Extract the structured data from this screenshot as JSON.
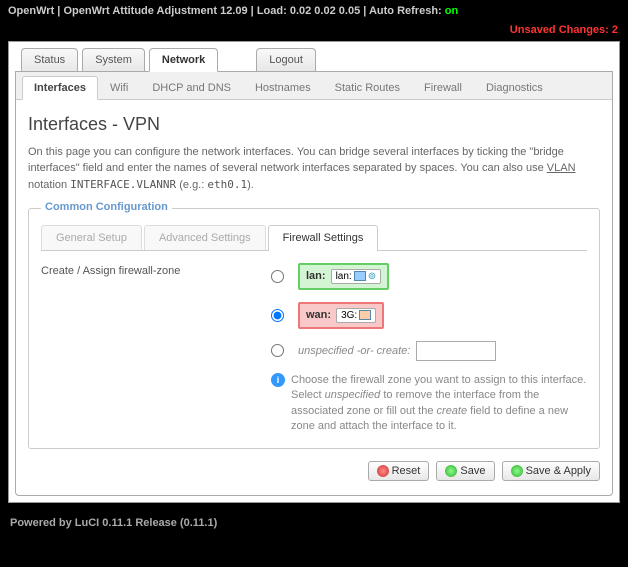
{
  "header": {
    "brand": "OpenWrt",
    "subtitle": "OpenWrt Attitude Adjustment 12.09",
    "load_label": "Load:",
    "load_values": "0.02 0.02 0.05",
    "autorefresh_label": "Auto Refresh:",
    "autorefresh_state": "on"
  },
  "unsaved": "Unsaved Changes: 2",
  "maintabs": {
    "status": "Status",
    "system": "System",
    "network": "Network",
    "logout": "Logout"
  },
  "subtabs": {
    "interfaces": "Interfaces",
    "wifi": "Wifi",
    "dhcp": "DHCP and DNS",
    "hostnames": "Hostnames",
    "static": "Static Routes",
    "firewall": "Firewall",
    "diag": "Diagnostics"
  },
  "page": {
    "title": "Interfaces - VPN",
    "desc_1": "On this page you can configure the network interfaces. You can bridge several interfaces by ticking the \"bridge interfaces\" field and enter the names of several network interfaces separated by spaces. You can also use ",
    "desc_vlan": "VLAN",
    "desc_2": " notation ",
    "desc_code1": "INTERFACE.VLANNR",
    "desc_3": " (e.g.: ",
    "desc_code2": "eth0.1",
    "desc_4": ")."
  },
  "fieldset": {
    "legend": "Common Configuration",
    "tabs": {
      "general": "General Setup",
      "advanced": "Advanced Settings",
      "firewall": "Firewall Settings"
    },
    "label": "Create / Assign firewall-zone",
    "zones": {
      "lan_name": "lan:",
      "lan_badge": "lan:",
      "wan_name": "wan:",
      "wan_badge": "3G:",
      "unspec": "unspecified -or- create:"
    },
    "hint": "Choose the firewall zone you want to assign to this interface. Select unspecified to remove the interface from the associated zone or fill out the create field to define a new zone and attach the interface to it."
  },
  "actions": {
    "reset": "Reset",
    "save": "Save",
    "saveapply": "Save & Apply"
  },
  "footer": "Powered by LuCI 0.11.1 Release (0.11.1)"
}
